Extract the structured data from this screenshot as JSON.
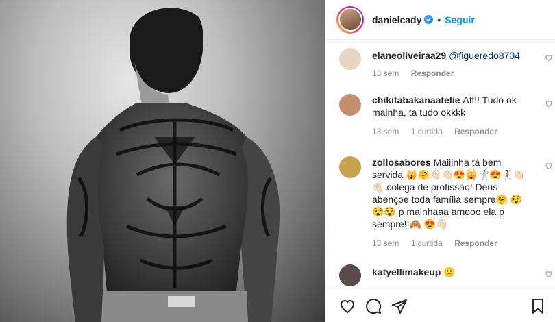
{
  "post": {
    "username": "danielcady",
    "separator": "•",
    "follow_label": "Seguir"
  },
  "comments": [
    {
      "username": "elaneoliveiraa29",
      "text": "@figueredo8704",
      "time": "13 sem",
      "likes": "",
      "reply_label": "Responder",
      "avatar_color": "#e8d6c0"
    },
    {
      "username": "chikitabakanaatelie",
      "text": "Aff!! Tudo ok mainha, ta tudo okkkk",
      "time": "13 sem",
      "likes": "1 curtida",
      "reply_label": "Responder",
      "avatar_color": "#c48f6f"
    },
    {
      "username": "zollosabores",
      "text": "Maiiinha tá bem servida 🙀🤗👋🏻👋🏻😍🙀🤺😍🤾🏻👋🏻👋🏻 colega de profissão! Deus abençoe toda família sempre🤗 😵😵😵 p mainhaaa amooo ela p sempre!!🙈 😍👋🏻",
      "time": "13 sem",
      "likes": "1 curtida",
      "reply_label": "Responder",
      "avatar_color": "#c8a24a"
    },
    {
      "username": "katyellimakeup",
      "text": "😕",
      "time": "",
      "likes": "",
      "reply_label": "",
      "avatar_color": "#5a4a48"
    }
  ],
  "icons": {
    "like": "heart-outline-icon",
    "comment": "comment-bubble-icon",
    "share": "paper-plane-icon",
    "save": "bookmark-icon"
  }
}
